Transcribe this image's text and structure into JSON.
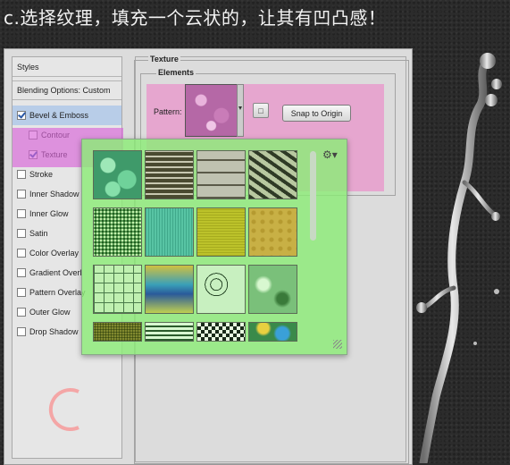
{
  "caption": "c.选择纹理，填充一个云状的，让其有凹凸感！",
  "sidebar": {
    "title": "Styles",
    "blending": "Blending Options: Custom",
    "items": [
      {
        "label": "Bevel & Emboss",
        "checked": true,
        "sub": false,
        "selected": true
      },
      {
        "label": "Contour",
        "checked": false,
        "sub": true,
        "selected": false
      },
      {
        "label": "Texture",
        "checked": true,
        "sub": true,
        "selected": false
      },
      {
        "label": "Stroke",
        "checked": false,
        "sub": false,
        "selected": false
      },
      {
        "label": "Inner Shadow",
        "checked": false,
        "sub": false,
        "selected": false
      },
      {
        "label": "Inner Glow",
        "checked": false,
        "sub": false,
        "selected": false
      },
      {
        "label": "Satin",
        "checked": false,
        "sub": false,
        "selected": false
      },
      {
        "label": "Color Overlay",
        "checked": false,
        "sub": false,
        "selected": false
      },
      {
        "label": "Gradient Overl",
        "checked": false,
        "sub": false,
        "selected": false
      },
      {
        "label": "Pattern Overlay",
        "checked": false,
        "sub": false,
        "selected": false
      },
      {
        "label": "Outer Glow",
        "checked": false,
        "sub": false,
        "selected": false
      },
      {
        "label": "Drop Shadow",
        "checked": false,
        "sub": false,
        "selected": false
      }
    ]
  },
  "panel": {
    "group_title": "Texture",
    "subgroup_title": "Elements",
    "pattern_label": "Pattern:",
    "snap_button": "Snap to Origin"
  },
  "picker": {
    "tiles": [
      "green-bubbles",
      "weave-dark",
      "brick-stack",
      "zebra-stripes",
      "green-noise",
      "teal-fabric",
      "olive-canvas",
      "dotted-grid",
      "green-tiles",
      "blue-gradient-waves",
      "contour-lines",
      "crumpled-green",
      "olive-granite",
      "concentric-squares",
      "checkerboard",
      "colorful-marble"
    ]
  },
  "decor": {
    "big_letter": "C"
  },
  "colors": {
    "pattern_highlight": "#ee7ac4",
    "picker_highlight": "#8cec78",
    "texture_highlight": "#d864d8",
    "selected_item": "#b8cde8"
  }
}
